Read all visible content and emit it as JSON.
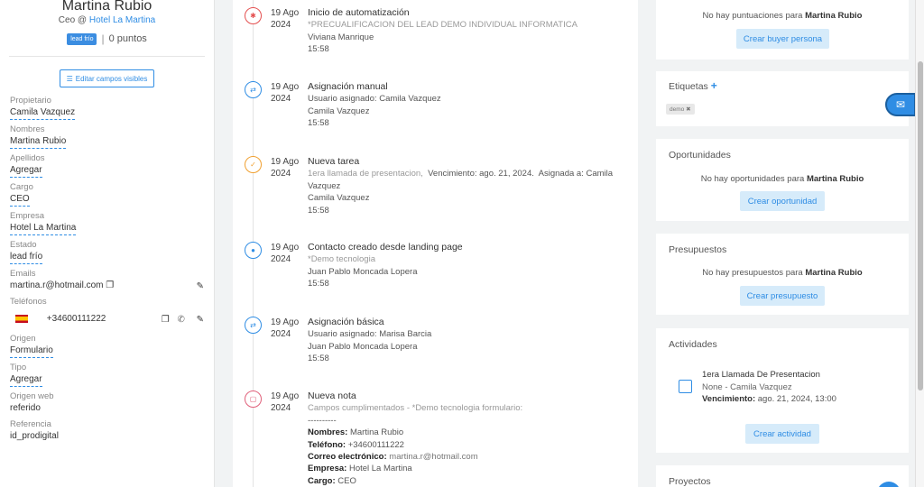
{
  "contact": {
    "name": "Martina Rubio",
    "role_prefix": "Ceo @",
    "company_link": "Hotel La Martina",
    "lead_tag": "lead frío",
    "points": "0 puntos",
    "edit_fields_label": "Editar campos visibles"
  },
  "fields": {
    "owner_label": "Propietario",
    "owner_value": "Camila Vazquez",
    "first_name_label": "Nombres",
    "first_name_value": "Martina Rubio",
    "last_name_label": "Apellidos",
    "last_name_value": "Agregar",
    "position_label": "Cargo",
    "position_value": "CEO",
    "company_label": "Empresa",
    "company_value": "Hotel La Martina",
    "status_label": "Estado",
    "status_value": "lead frío",
    "emails_label": "Emails",
    "email_value": "martina.r@hotmail.com",
    "phones_label": "Teléfonos",
    "phone_value": "+34600111222",
    "origin_label": "Origen",
    "origin_value": "Formulario",
    "type_label": "Tipo",
    "type_value": "Agregar",
    "web_origin_label": "Origen web",
    "web_origin_value": "referido",
    "reference_label": "Referencia",
    "reference_value": "id_prodigital"
  },
  "timeline": [
    {
      "day": "19 Ago",
      "year": "2024",
      "title": "Inicio de automatización",
      "lines": [
        "*PRECUALIFICACION DEL LEAD DEMO INDIVIDUAL INFORMATICA",
        "Viviana Manrique",
        "15:58"
      ]
    },
    {
      "day": "19 Ago",
      "year": "2024",
      "title": "Asignación manual",
      "lines": [
        "Usuario asignado: Camila Vazquez",
        "Camila Vazquez",
        "15:58"
      ]
    },
    {
      "day": "19 Ago",
      "year": "2024",
      "title": "Nueva tarea",
      "lines": [
        "1era llamada de presentacion,",
        "Vencimiento: ago. 21, 2024.",
        "Asignada a: Camila",
        "Vazquez",
        "Camila Vazquez",
        "15:58"
      ]
    },
    {
      "day": "19 Ago",
      "year": "2024",
      "title": "Contacto creado desde landing page",
      "lines": [
        "*Demo tecnologia",
        "Juan Pablo Moncada Lopera",
        "15:58"
      ]
    },
    {
      "day": "19 Ago",
      "year": "2024",
      "title": "Asignación básica",
      "lines": [
        "Usuario asignado: Marisa Barcia",
        "Juan Pablo Moncada Lopera",
        "15:58"
      ]
    },
    {
      "day": "19 Ago",
      "year": "2024",
      "title": "Nueva nota",
      "lines": [
        "Campos cumplimentados - *Demo tecnologia formulario:",
        "----------",
        "Nombres:",
        "Martina Rubio",
        "Teléfono:",
        "+34600111222",
        "Correo electrónico:",
        "martina.r@hotmail.com",
        "Empresa:",
        "Hotel La Martina",
        "Cargo:",
        "CEO"
      ]
    }
  ],
  "right": {
    "scores_msg": "No hay puntuaciones para",
    "contact_name": "Martina Rubio",
    "buyer_btn": "Crear buyer persona",
    "tags_title": "Etiquetas",
    "tags_add": "+",
    "tag_chip": "demo",
    "tag_remove": "✖",
    "opps_title": "Oportunidades",
    "opps_msg": "No hay oportunidades para",
    "opps_btn": "Crear oportunidad",
    "budgets_title": "Presupuestos",
    "budgets_msg": "No hay presupuestos para",
    "budgets_btn": "Crear presupuesto",
    "activities_title": "Actividades",
    "activity_name": "1era Llamada De Presentacion",
    "activity_meta": "None - Camila Vazquez",
    "activity_due_label": "Vencimiento:",
    "activity_due_value": "ago. 21, 2024, 13:00",
    "activity_btn": "Crear actividad",
    "projects_title": "Proyectos"
  },
  "icons": {
    "automation": "gear-icon",
    "assign": "swap-icon",
    "task": "check-icon",
    "contact": "person-icon",
    "note": "note-icon",
    "copy": "copy-icon",
    "edit": "pencil-icon",
    "whatsapp": "whatsapp-icon",
    "mail": "mail-icon"
  },
  "colors": {
    "accent": "#2f8de4",
    "automation": "#e45050",
    "task": "#f0a030",
    "note": "#e0607a"
  }
}
